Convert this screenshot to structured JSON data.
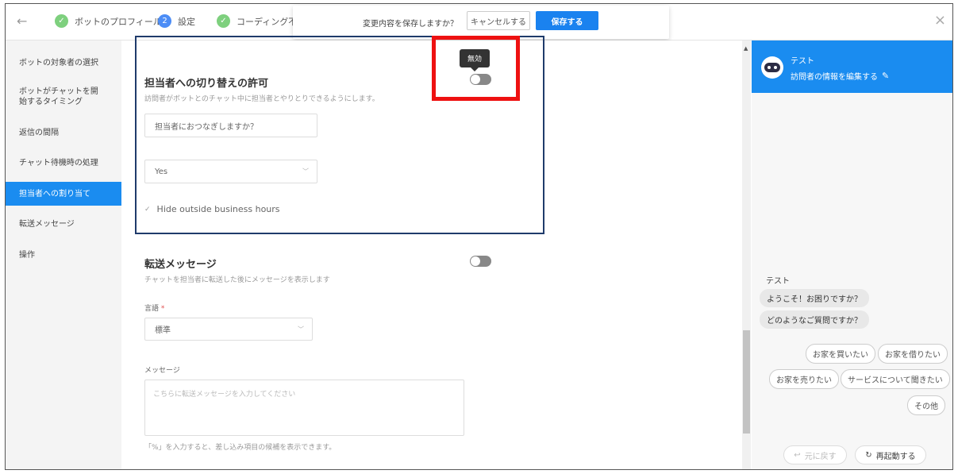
{
  "topbar": {
    "steps": [
      {
        "label": "ボットのプロフィール",
        "state": "done"
      },
      {
        "label": "設定",
        "state": "current",
        "number": "2"
      },
      {
        "label": "コーディング不要の",
        "state": "done"
      }
    ]
  },
  "save_popup": {
    "message": "変更内容を保存しますか？",
    "cancel_label": "キャンセルする",
    "save_label": "保存する"
  },
  "sidebar": {
    "items": [
      {
        "label": "ボットの対象者の選択",
        "active": false
      },
      {
        "label": "ボットがチャットを開始するタイミング",
        "active": false
      },
      {
        "label": "返信の間隔",
        "active": false
      },
      {
        "label": "チャット待機時の処理",
        "active": false
      },
      {
        "label": "担当者への割り当て",
        "active": true
      },
      {
        "label": "転送メッセージ",
        "active": false
      },
      {
        "label": "操作",
        "active": false
      }
    ]
  },
  "handoff": {
    "title": "担当者への切り替えの許可",
    "description": "訪問者がボットとのチャット中に担当者とやりとりできるようにします。",
    "tooltip": "無効",
    "question_placeholder": "担当者におつなぎしますか？",
    "select_value": "Yes",
    "hide_label": "Hide outside business hours"
  },
  "transfer": {
    "title": "転送メッセージ",
    "description": "チャットを担当者に転送した後にメッセージを表示します",
    "language_label": "言語",
    "required_mark": "*",
    "language_value": "標準",
    "message_label": "メッセージ",
    "message_placeholder": "こちらに転送メッセージを入力してください",
    "hint": "「%」を入力すると、差し込み項目の候補を表示できます。"
  },
  "preview": {
    "bot_name": "テスト",
    "edit_visitor": "訪問者の情報を編集する",
    "chat_sender": "テスト",
    "messages": [
      "ようこそ！お困りですか？",
      "どのようなご質問ですか？"
    ],
    "chips": [
      "お家を買いたい",
      "お家を借りたい",
      "お家を売りたい",
      "サービスについて聞きたい",
      "その他"
    ],
    "undo_label": "元に戻す",
    "restart_label": "再起動する"
  },
  "colors": {
    "accent": "#1a8cf0",
    "highlight_red": "#ee1111",
    "section_border": "#1f3b6b"
  }
}
